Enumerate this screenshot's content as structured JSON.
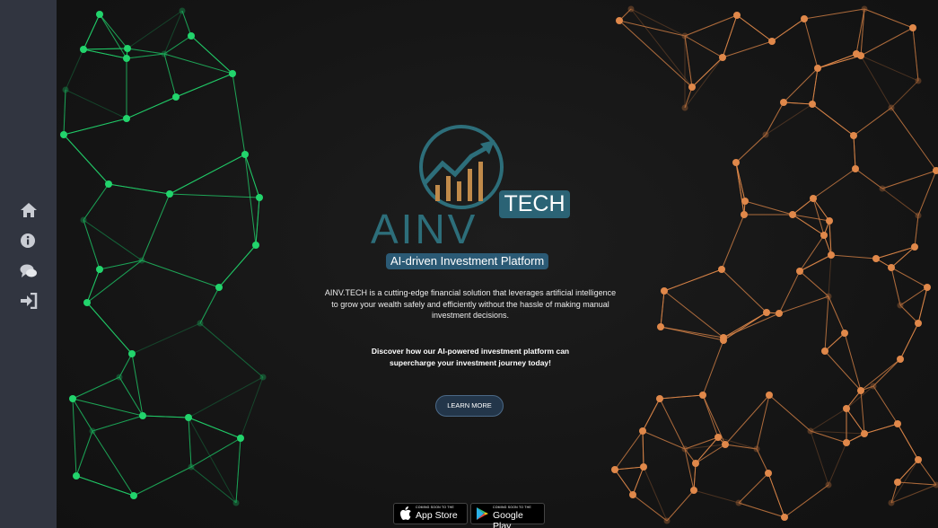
{
  "sidebar": {
    "items": [
      {
        "icon": "home-icon"
      },
      {
        "icon": "info-icon"
      },
      {
        "icon": "chat-icon"
      },
      {
        "icon": "sign-in-icon"
      }
    ]
  },
  "hero": {
    "logo_text": "AINV",
    "logo_badge": "TECH",
    "tagline": "AI-driven Investment Platform",
    "description": "AINV.TECH is a cutting-edge financial solution that leverages artificial intelligence to grow your wealth safely and efficiently without the hassle of making manual investment decisions.",
    "cta_text": "Discover how our AI-powered investment platform can supercharge your investment journey today!",
    "learn_more_label": "LEARN MORE"
  },
  "stores": {
    "apple": {
      "coming": "COMING SOON TO THE",
      "name": "App Store"
    },
    "google": {
      "coming": "COMING SOON TO THE",
      "name": "Google Play"
    }
  },
  "colors": {
    "sidebar_bg": "#313540",
    "green_node": "#22d46c",
    "orange_node": "#e0884a",
    "brand_teal": "#2d6e7a"
  }
}
